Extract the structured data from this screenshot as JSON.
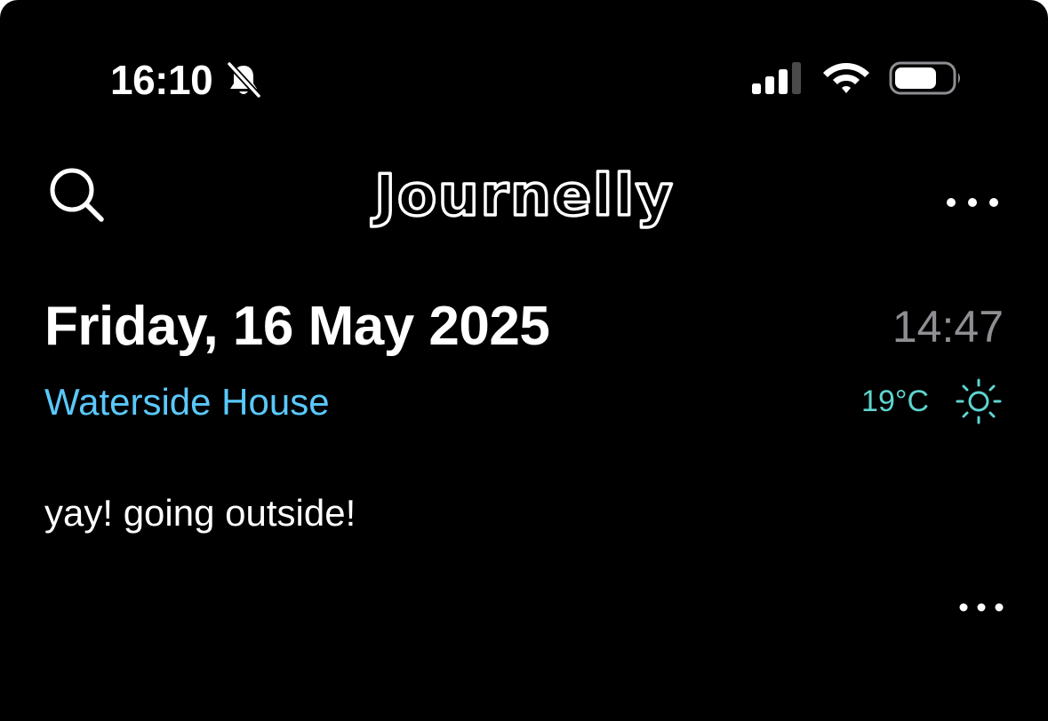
{
  "status_bar": {
    "time": "16:10",
    "icons": [
      "bell-slash-icon",
      "cellular-signal-icon",
      "wifi-icon",
      "battery-icon"
    ]
  },
  "nav": {
    "app_title": "Journelly",
    "icons": [
      "search-icon",
      "more-icon"
    ]
  },
  "entry": {
    "date": "Friday, 16 May 2025",
    "time": "14:47",
    "location": "Waterside House",
    "temperature": "19°C",
    "weather_icon": "sun-icon",
    "body": "yay! going outside!",
    "actions_icon": "more-icon"
  },
  "colors": {
    "background": "#000000",
    "text": "#ffffff",
    "secondary_text": "#8e8e93",
    "location": "#5ac8fa",
    "weather": "#5fd4cf"
  }
}
